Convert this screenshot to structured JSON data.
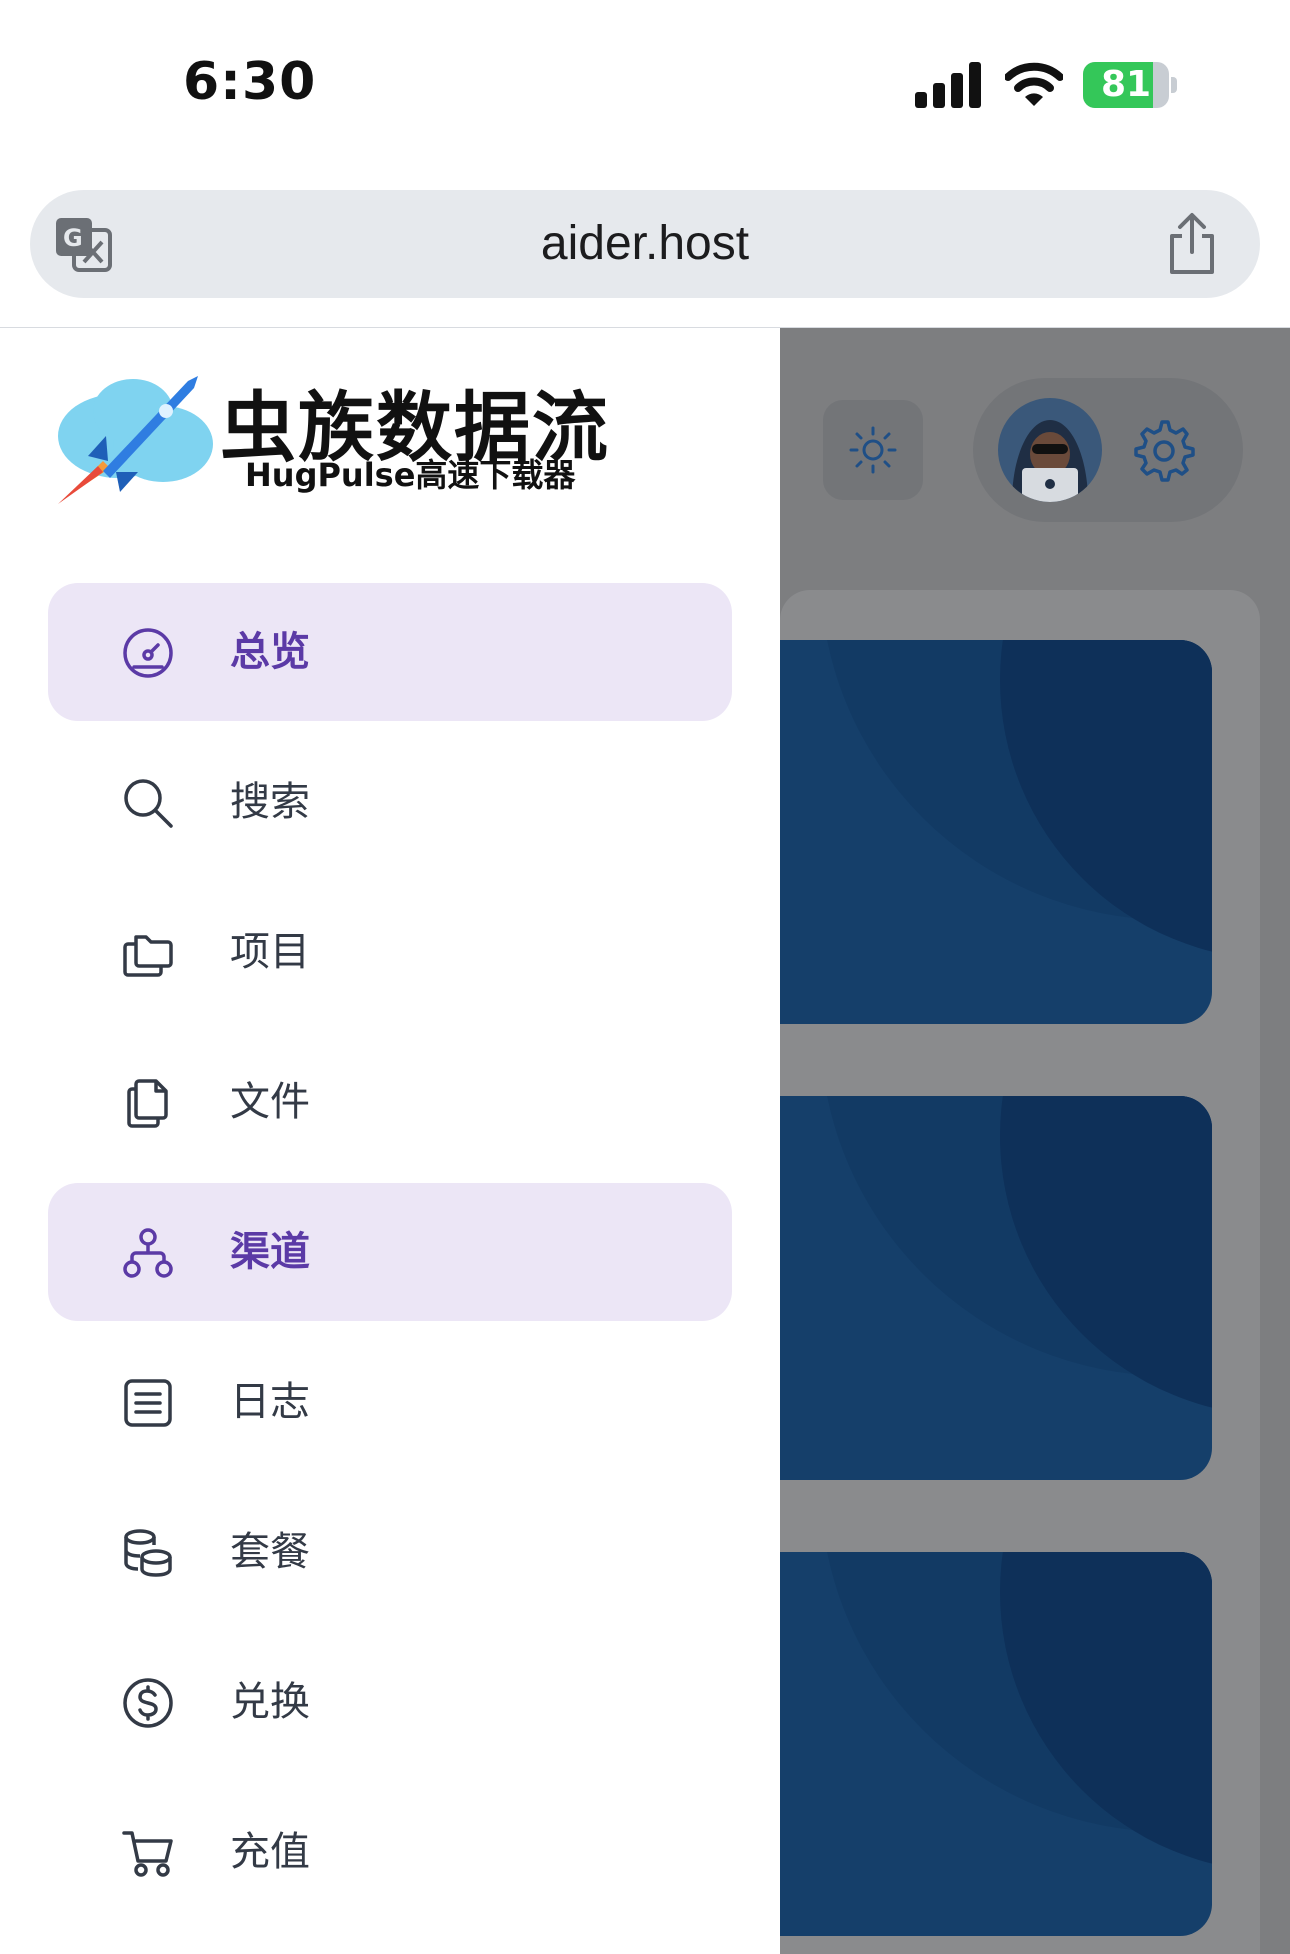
{
  "status_bar": {
    "time": "6:30",
    "battery": "81",
    "battery_level": 0.81
  },
  "browser": {
    "url": "aider.host"
  },
  "brand": {
    "title": "虫族数据流",
    "subtitle": "HugPulse高速下载器"
  },
  "colors": {
    "accent": "#5b3aa6",
    "active_bg": "#ece6f6",
    "icon": "#333a46",
    "overlay": "#7d7e80",
    "card": "#153f6a"
  },
  "nav": {
    "items": [
      {
        "label": "总览",
        "icon": "dashboard-icon",
        "active": true
      },
      {
        "label": "搜索",
        "icon": "search-icon",
        "active": false
      },
      {
        "label": "项目",
        "icon": "folders-icon",
        "active": false
      },
      {
        "label": "文件",
        "icon": "files-icon",
        "active": false
      },
      {
        "label": "渠道",
        "icon": "channel-hierarchy-icon",
        "active": true
      },
      {
        "label": "日志",
        "icon": "log-list-icon",
        "active": false
      },
      {
        "label": "套餐",
        "icon": "coins-stack-icon",
        "active": false
      },
      {
        "label": "兑换",
        "icon": "dollar-circle-icon",
        "active": false
      },
      {
        "label": "充值",
        "icon": "shopping-cart-icon",
        "active": false
      }
    ]
  }
}
